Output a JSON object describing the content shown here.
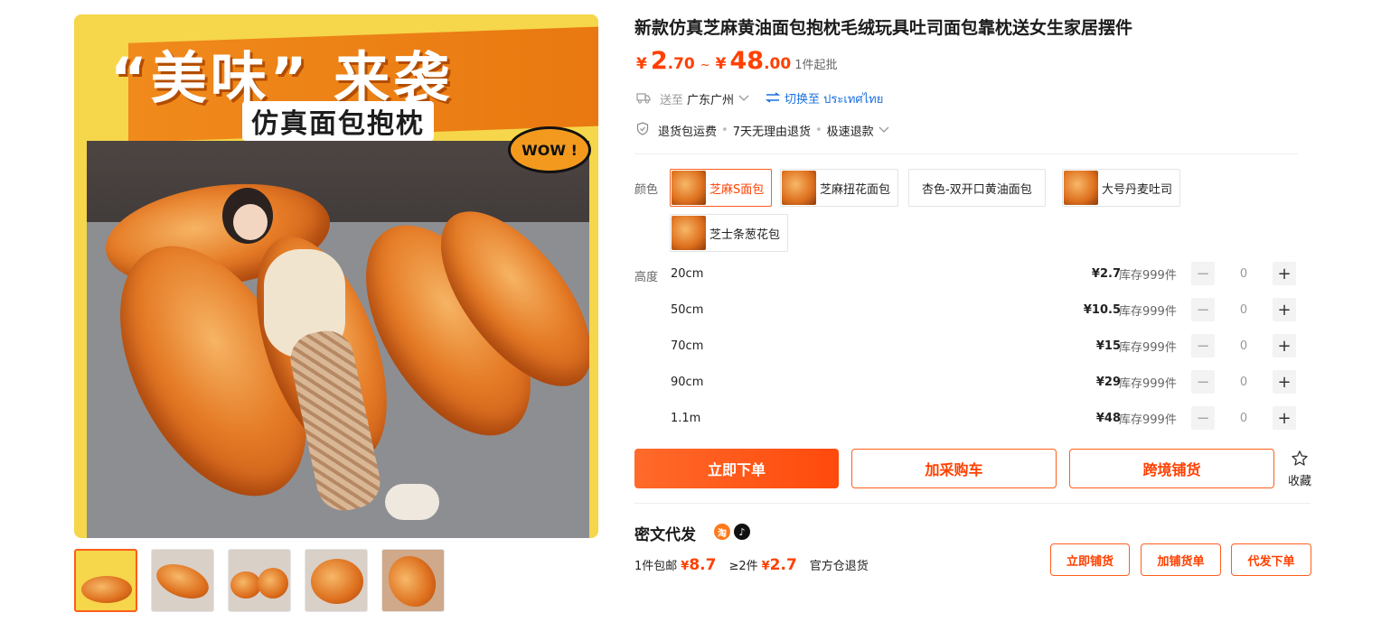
{
  "gallery": {
    "banner_title": "“美味” 来袭",
    "banner_subtitle": "仿真面包抱枕",
    "wow_text": "WOW !",
    "thumbnail_count": 5
  },
  "product": {
    "title": "新款仿真芝麻黄油面包抱枕毛绒玩具吐司面包靠枕送女生家居摆件",
    "price_currency": "¥",
    "price_min_int": "2",
    "price_min_dec": ".70",
    "price_max_int": "48",
    "price_max_dec": ".00",
    "price_separator": "~",
    "moq": "1件起批"
  },
  "shipping": {
    "icon": "truck-icon",
    "to_label": "送至",
    "location": "广东广州",
    "switch_label": "切换至 ประเทศไทย"
  },
  "services": {
    "icon": "shield-icon",
    "items": [
      "退货包运费",
      "7天无理由退货",
      "极速退款"
    ]
  },
  "colors": {
    "label": "颜色",
    "options": [
      {
        "label": "芝麻S面包",
        "selected": true,
        "has_image": true
      },
      {
        "label": "芝麻扭花面包",
        "selected": false,
        "has_image": true
      },
      {
        "label": "杏色-双开口黄油面包",
        "selected": false,
        "has_image": false
      },
      {
        "label": "大号丹麦吐司",
        "selected": false,
        "has_image": true
      },
      {
        "label": "芝士条葱花包",
        "selected": false,
        "has_image": true
      }
    ]
  },
  "heights": {
    "label": "高度",
    "rows": [
      {
        "name": "20cm",
        "price": "¥2.7",
        "stock": "库存999件",
        "qty": "0"
      },
      {
        "name": "50cm",
        "price": "¥10.5",
        "stock": "库存999件",
        "qty": "0"
      },
      {
        "name": "70cm",
        "price": "¥15",
        "stock": "库存999件",
        "qty": "0"
      },
      {
        "name": "90cm",
        "price": "¥29",
        "stock": "库存999件",
        "qty": "0"
      },
      {
        "name": "1.1m",
        "price": "¥48",
        "stock": "库存999件",
        "qty": "0"
      }
    ]
  },
  "actions": {
    "buy_now": "立即下单",
    "add_cart": "加采购车",
    "cross_border": "跨境铺货",
    "favorite": "收藏"
  },
  "dropship": {
    "title": "密文代发",
    "taobao_icon": "淘",
    "douyin_icon": "♪",
    "one_label": "1件包邮",
    "one_price_yen": "¥",
    "one_price": "8.7",
    "two_label": "≥2件",
    "two_price_yen": "¥",
    "two_price": "2.7",
    "return_label": "官方仓退货",
    "btn_list": "立即铺货",
    "btn_add": "加铺货单",
    "btn_order": "代发下单"
  },
  "colors_theme": {
    "accent": "#ff4000",
    "accent_border": "#ff5e1b",
    "link": "#1a6fe0"
  }
}
